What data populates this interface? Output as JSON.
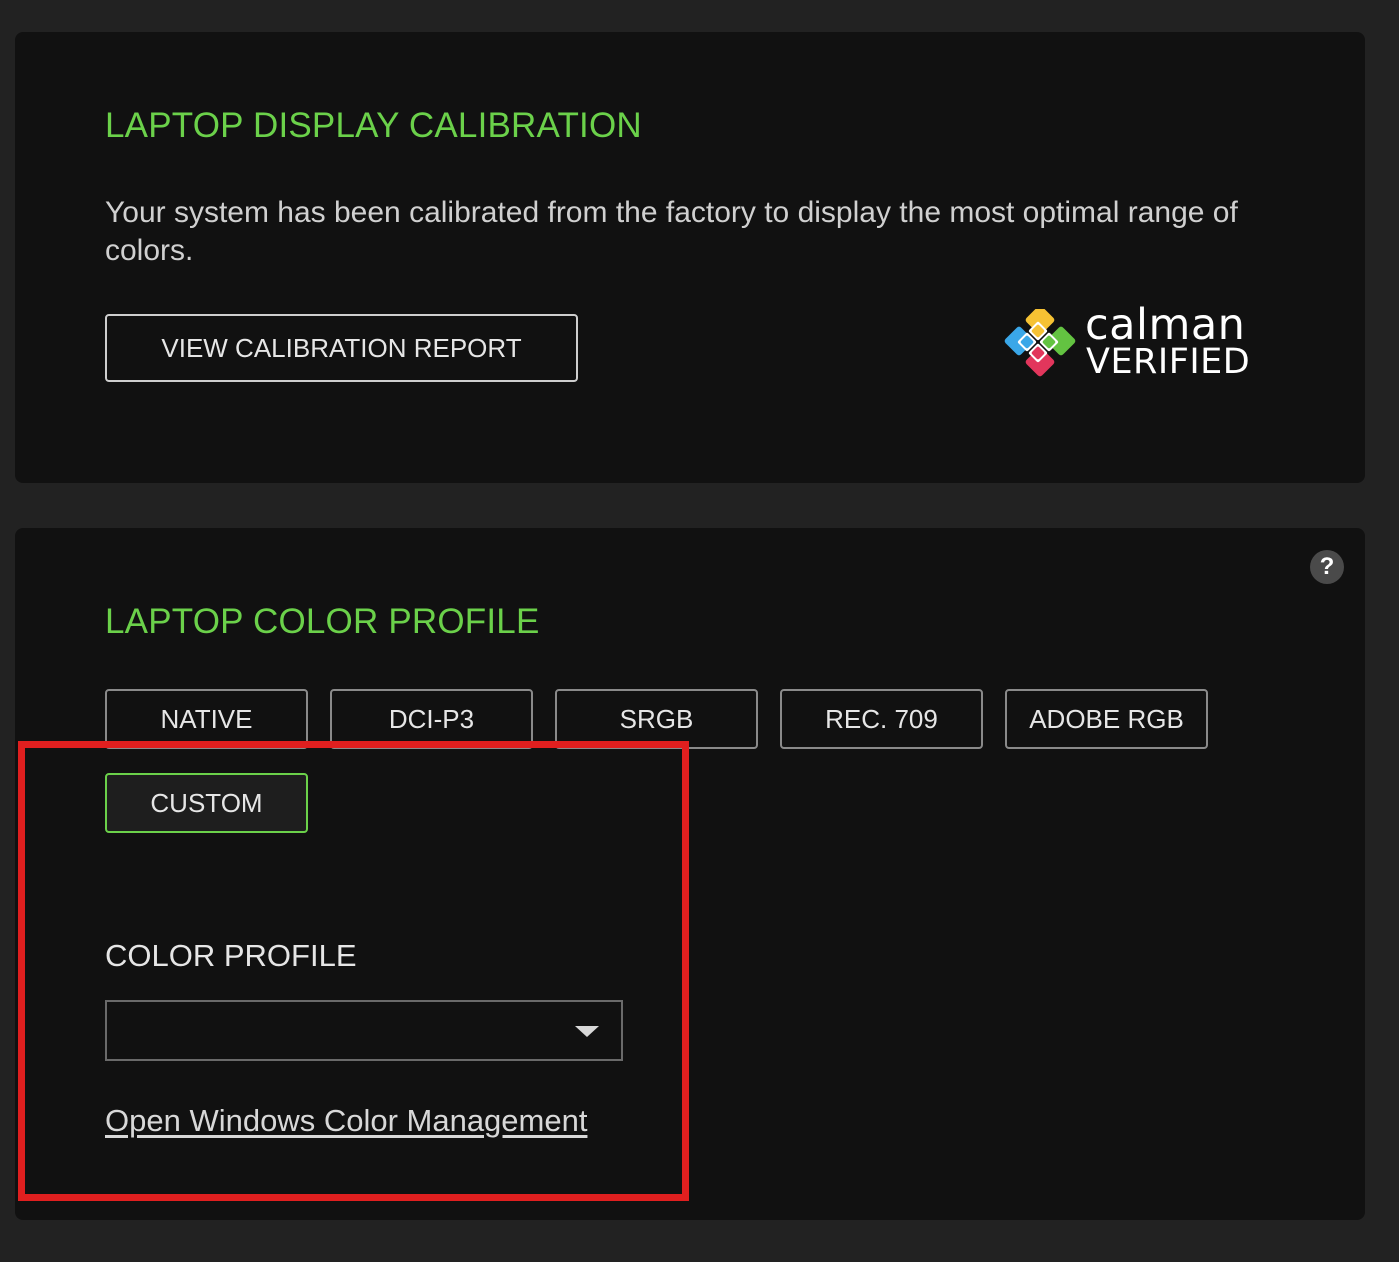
{
  "calibration": {
    "title": "LAPTOP DISPLAY CALIBRATION",
    "description": "Your system has been calibrated from the factory to display the most optimal range of colors.",
    "view_report_label": "VIEW CALIBRATION REPORT",
    "logo": {
      "word": "calman",
      "subword": "VERIFIED"
    }
  },
  "profile": {
    "title": "LAPTOP COLOR PROFILE",
    "help_icon": "?",
    "presets": [
      {
        "label": "NATIVE",
        "selected": false
      },
      {
        "label": "DCI-P3",
        "selected": false
      },
      {
        "label": "SRGB",
        "selected": false
      },
      {
        "label": "REC. 709",
        "selected": false
      },
      {
        "label": "ADOBE RGB",
        "selected": false
      },
      {
        "label": "CUSTOM",
        "selected": true
      }
    ],
    "color_profile_label": "COLOR PROFILE",
    "color_profile_value": "",
    "link_label": "Open Windows Color Management"
  },
  "colors": {
    "accent_green": "#6bd14a",
    "highlight_red": "#e01f1f",
    "panel_bg": "#111111",
    "page_bg": "#222222"
  }
}
